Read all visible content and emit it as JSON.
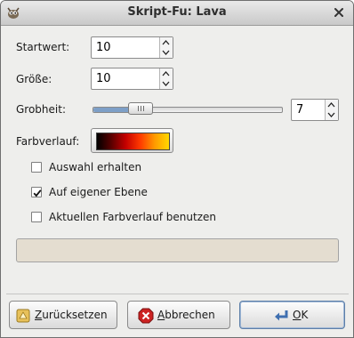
{
  "window": {
    "title": "Skript-Fu: Lava"
  },
  "fields": {
    "startwert": {
      "label": "Startwert:",
      "value": "10"
    },
    "groesse": {
      "label": "Größe:",
      "value": "10"
    },
    "grobheit": {
      "label": "Grobheit:",
      "value": "7",
      "slider_fraction": 0.22
    },
    "farbverlauf": {
      "label": "Farbverlauf:",
      "gradient_colors": [
        "#000000",
        "#5a0000",
        "#c40000",
        "#ff3a00",
        "#ff9a00",
        "#ffd800"
      ]
    }
  },
  "options": [
    {
      "label": "Auswahl erhalten",
      "checked": false
    },
    {
      "label": "Auf eigener Ebene",
      "checked": true
    },
    {
      "label": "Aktuellen Farbverlauf benutzen",
      "checked": false
    }
  ],
  "buttons": {
    "reset": {
      "label": "Zurücksetzen",
      "mnemonic": "Z",
      "rest": "urücksetzen"
    },
    "cancel": {
      "label": "Abbrechen",
      "mnemonic": "A",
      "rest": "bbrechen"
    },
    "ok": {
      "label": "OK",
      "mnemonic": "O",
      "rest": "K"
    }
  },
  "colors": {
    "accent": "#5d7fa8",
    "progress_trough": "#e4ddd0",
    "cancel_icon": "#cc2222"
  },
  "icons": [
    "gimp-wilber-icon",
    "close-icon",
    "broom-icon",
    "cancel-icon",
    "enter-arrow-icon"
  ]
}
